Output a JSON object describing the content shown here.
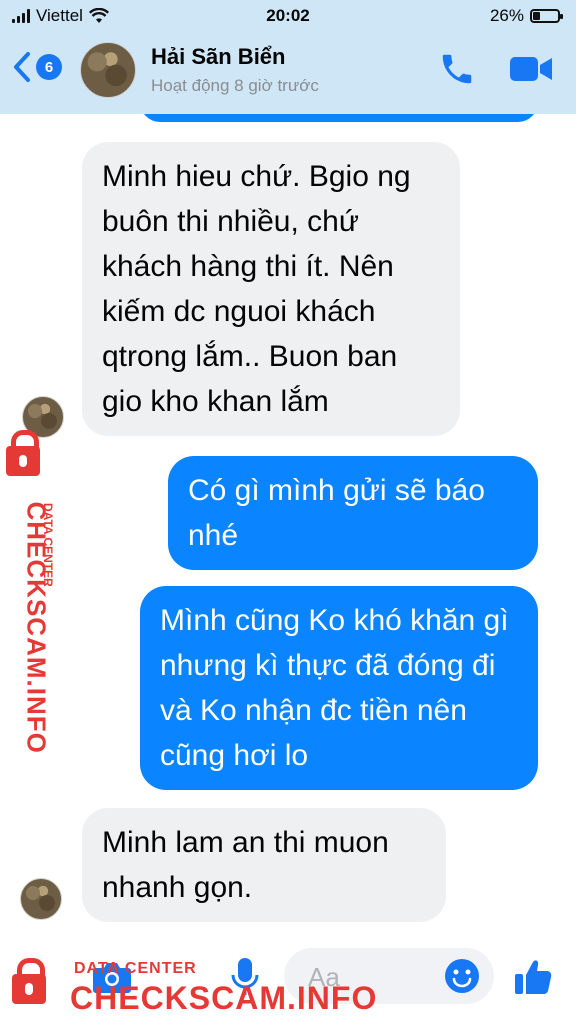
{
  "status_bar": {
    "carrier": "Viettel",
    "time": "20:02",
    "battery_percent_label": "26%",
    "battery_level": 0.26
  },
  "header": {
    "back_count": "6",
    "contact_name": "Hải Sãn Biển",
    "contact_status": "Hoạt động 8 giờ trước"
  },
  "messages": [
    {
      "direction": "incoming",
      "text": "Minh hieu chứ. Bgio ng buôn thi nhiều, chứ khách hàng thi ít. Nên kiếm dc nguoi khách qtrong lắm.. Buon ban gio kho khan lắm"
    },
    {
      "direction": "outgoing",
      "text": "Có gì mình gửi sẽ báo nhé"
    },
    {
      "direction": "outgoing",
      "text": "Mình cũng Ko khó khăn gì nhưng kì thực đã đóng đi và Ko nhận đc tiền nên cũng hơi lo"
    },
    {
      "direction": "incoming",
      "text": "Minh lam an thi muon nhanh gọn."
    }
  ],
  "composer": {
    "placeholder": "Aa"
  },
  "watermark": {
    "small": "DATA CENTER",
    "big": "CHECKSCAM.INFO"
  },
  "colors": {
    "accent": "#0a84ff",
    "incoming_bubble": "#eff0f2",
    "header_bg": "#cfe6f7",
    "watermark": "#e53935"
  }
}
